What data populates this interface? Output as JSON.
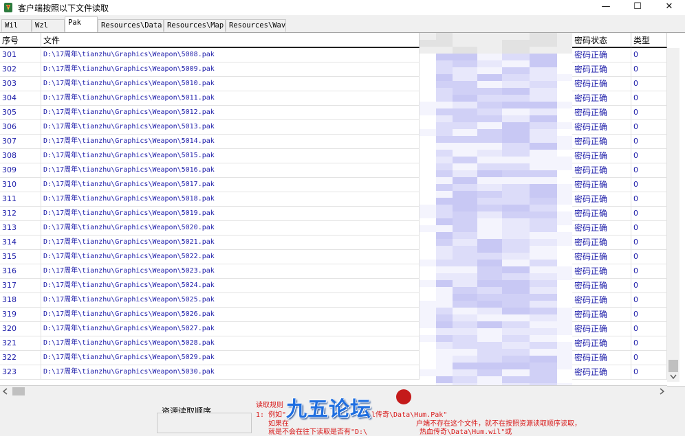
{
  "window": {
    "title": "客户端按照以下文件读取",
    "minimize": "—",
    "maximize": "☐",
    "close": "✕"
  },
  "tabs": [
    "Wil",
    "Wzl",
    "Pak",
    "Resources\\Data",
    "Resources\\Map",
    "Resources\\Wav"
  ],
  "active_tab": "Pak",
  "grid": {
    "headers": {
      "num": "序号",
      "file": "文件",
      "status": "密码状态",
      "type": "类型"
    },
    "rows": [
      {
        "num": "301",
        "file": "D:\\17周年\\tianzhu\\Graphics\\Weapon\\5008.pak",
        "status": "密码正确",
        "type": "0"
      },
      {
        "num": "302",
        "file": "D:\\17周年\\tianzhu\\Graphics\\Weapon\\5009.pak",
        "status": "密码正确",
        "type": "0"
      },
      {
        "num": "303",
        "file": "D:\\17周年\\tianzhu\\Graphics\\Weapon\\5010.pak",
        "status": "密码正确",
        "type": "0"
      },
      {
        "num": "304",
        "file": "D:\\17周年\\tianzhu\\Graphics\\Weapon\\5011.pak",
        "status": "密码正确",
        "type": "0"
      },
      {
        "num": "305",
        "file": "D:\\17周年\\tianzhu\\Graphics\\Weapon\\5012.pak",
        "status": "密码正确",
        "type": "0"
      },
      {
        "num": "306",
        "file": "D:\\17周年\\tianzhu\\Graphics\\Weapon\\5013.pak",
        "status": "密码正确",
        "type": "0"
      },
      {
        "num": "307",
        "file": "D:\\17周年\\tianzhu\\Graphics\\Weapon\\5014.pak",
        "status": "密码正确",
        "type": "0"
      },
      {
        "num": "308",
        "file": "D:\\17周年\\tianzhu\\Graphics\\Weapon\\5015.pak",
        "status": "密码正确",
        "type": "0"
      },
      {
        "num": "309",
        "file": "D:\\17周年\\tianzhu\\Graphics\\Weapon\\5016.pak",
        "status": "密码正确",
        "type": "0"
      },
      {
        "num": "310",
        "file": "D:\\17周年\\tianzhu\\Graphics\\Weapon\\5017.pak",
        "status": "密码正确",
        "type": "0"
      },
      {
        "num": "311",
        "file": "D:\\17周年\\tianzhu\\Graphics\\Weapon\\5018.pak",
        "status": "密码正确",
        "type": "0"
      },
      {
        "num": "312",
        "file": "D:\\17周年\\tianzhu\\Graphics\\Weapon\\5019.pak",
        "status": "密码正确",
        "type": "0"
      },
      {
        "num": "313",
        "file": "D:\\17周年\\tianzhu\\Graphics\\Weapon\\5020.pak",
        "status": "密码正确",
        "type": "0"
      },
      {
        "num": "314",
        "file": "D:\\17周年\\tianzhu\\Graphics\\Weapon\\5021.pak",
        "status": "密码正确",
        "type": "0"
      },
      {
        "num": "315",
        "file": "D:\\17周年\\tianzhu\\Graphics\\Weapon\\5022.pak",
        "status": "密码正确",
        "type": "0"
      },
      {
        "num": "316",
        "file": "D:\\17周年\\tianzhu\\Graphics\\Weapon\\5023.pak",
        "status": "密码正确",
        "type": "0"
      },
      {
        "num": "317",
        "file": "D:\\17周年\\tianzhu\\Graphics\\Weapon\\5024.pak",
        "status": "密码正确",
        "type": "0"
      },
      {
        "num": "318",
        "file": "D:\\17周年\\tianzhu\\Graphics\\Weapon\\5025.pak",
        "status": "密码正确",
        "type": "0"
      },
      {
        "num": "319",
        "file": "D:\\17周年\\tianzhu\\Graphics\\Weapon\\5026.pak",
        "status": "密码正确",
        "type": "0"
      },
      {
        "num": "320",
        "file": "D:\\17周年\\tianzhu\\Graphics\\Weapon\\5027.pak",
        "status": "密码正确",
        "type": "0"
      },
      {
        "num": "321",
        "file": "D:\\17周年\\tianzhu\\Graphics\\Weapon\\5028.pak",
        "status": "密码正确",
        "type": "0"
      },
      {
        "num": "322",
        "file": "D:\\17周年\\tianzhu\\Graphics\\Weapon\\5029.pak",
        "status": "密码正确",
        "type": "0"
      },
      {
        "num": "323",
        "file": "D:\\17周年\\tianzhu\\Graphics\\Weapon\\5030.pak",
        "status": "密码正确",
        "type": "0"
      }
    ]
  },
  "bottom": {
    "order_label": "资源读取顺序",
    "rules_title": "读取规则",
    "rule_line1": "1: 例如\"",
    "rule_line1_tail": "l传奇\\Data\\Hum.Pak\"",
    "rule_line2": "如果在",
    "rule_line2_tail": "户端不存在这个文件，就不在按照资源读取顺序读取，",
    "rule_line3": "就是不会在往下读取是否有\"D:\\",
    "rule_line3_tail": "热血传奇\\Data\\Hum.wil\"或",
    "watermark": "九五论坛"
  },
  "colors": {
    "link_blue": "#1a1aa8",
    "note_red": "#d81818",
    "blur_purple": "#c8c8f4"
  }
}
